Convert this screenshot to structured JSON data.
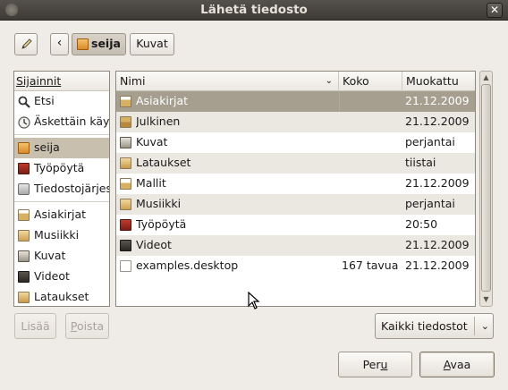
{
  "window": {
    "title": "Lähetä tiedosto",
    "close_glyph": "✕"
  },
  "toolbar": {
    "back_glyph": "‹",
    "breadcrumbs": [
      {
        "label": "seija",
        "icon": "home-folder-icon"
      },
      {
        "label": "Kuvat"
      }
    ]
  },
  "places": {
    "header": "Sijainnit",
    "items": [
      {
        "label": "Etsi",
        "icon": "search-icon"
      },
      {
        "label": "Äskettäin käytetyt",
        "icon": "recent-icon"
      },
      {
        "label": "seija",
        "icon": "home-folder-icon",
        "selected": true
      },
      {
        "label": "Työpöytä",
        "icon": "desktop-icon"
      },
      {
        "label": "Tiedostojärjestelmä",
        "icon": "drive-icon"
      },
      {
        "label": "Asiakirjat",
        "icon": "documents-folder-icon"
      },
      {
        "label": "Musiikki",
        "icon": "music-folder-icon"
      },
      {
        "label": "Kuvat",
        "icon": "pictures-folder-icon"
      },
      {
        "label": "Videot",
        "icon": "videos-folder-icon"
      },
      {
        "label": "Lataukset",
        "icon": "downloads-folder-icon"
      }
    ]
  },
  "files": {
    "columns": {
      "name": "Nimi",
      "size": "Koko",
      "modified": "Muokattu",
      "sort_glyph": "⌄"
    },
    "rows": [
      {
        "name": "Asiakirjat",
        "size": "",
        "modified": "21.12.2009",
        "icon": "documents-folder-icon",
        "selected": true
      },
      {
        "name": "Julkinen",
        "size": "",
        "modified": "21.12.2009",
        "icon": "public-folder-icon"
      },
      {
        "name": "Kuvat",
        "size": "",
        "modified": "perjantai",
        "icon": "pictures-folder-icon"
      },
      {
        "name": "Lataukset",
        "size": "",
        "modified": "tiistai",
        "icon": "downloads-folder-icon"
      },
      {
        "name": "Mallit",
        "size": "",
        "modified": "21.12.2009",
        "icon": "templates-folder-icon"
      },
      {
        "name": "Musiikki",
        "size": "",
        "modified": "perjantai",
        "icon": "music-folder-icon"
      },
      {
        "name": "Työpöytä",
        "size": "",
        "modified": "20:50",
        "icon": "desktop-icon"
      },
      {
        "name": "Videot",
        "size": "",
        "modified": "21.12.2009",
        "icon": "videos-folder-icon"
      },
      {
        "name": "examples.desktop",
        "size": "167 tavua",
        "modified": "21.12.2009",
        "icon": "file-icon"
      }
    ]
  },
  "buttons": {
    "add": "Lisää",
    "remove_first": "P",
    "remove_rest": "oista",
    "filter": "Kaikki tiedostot",
    "filter_chevron": "⌄",
    "cancel_first": "Per",
    "cancel_mn": "u",
    "ok_mn": "A",
    "ok_rest": "vaa"
  }
}
